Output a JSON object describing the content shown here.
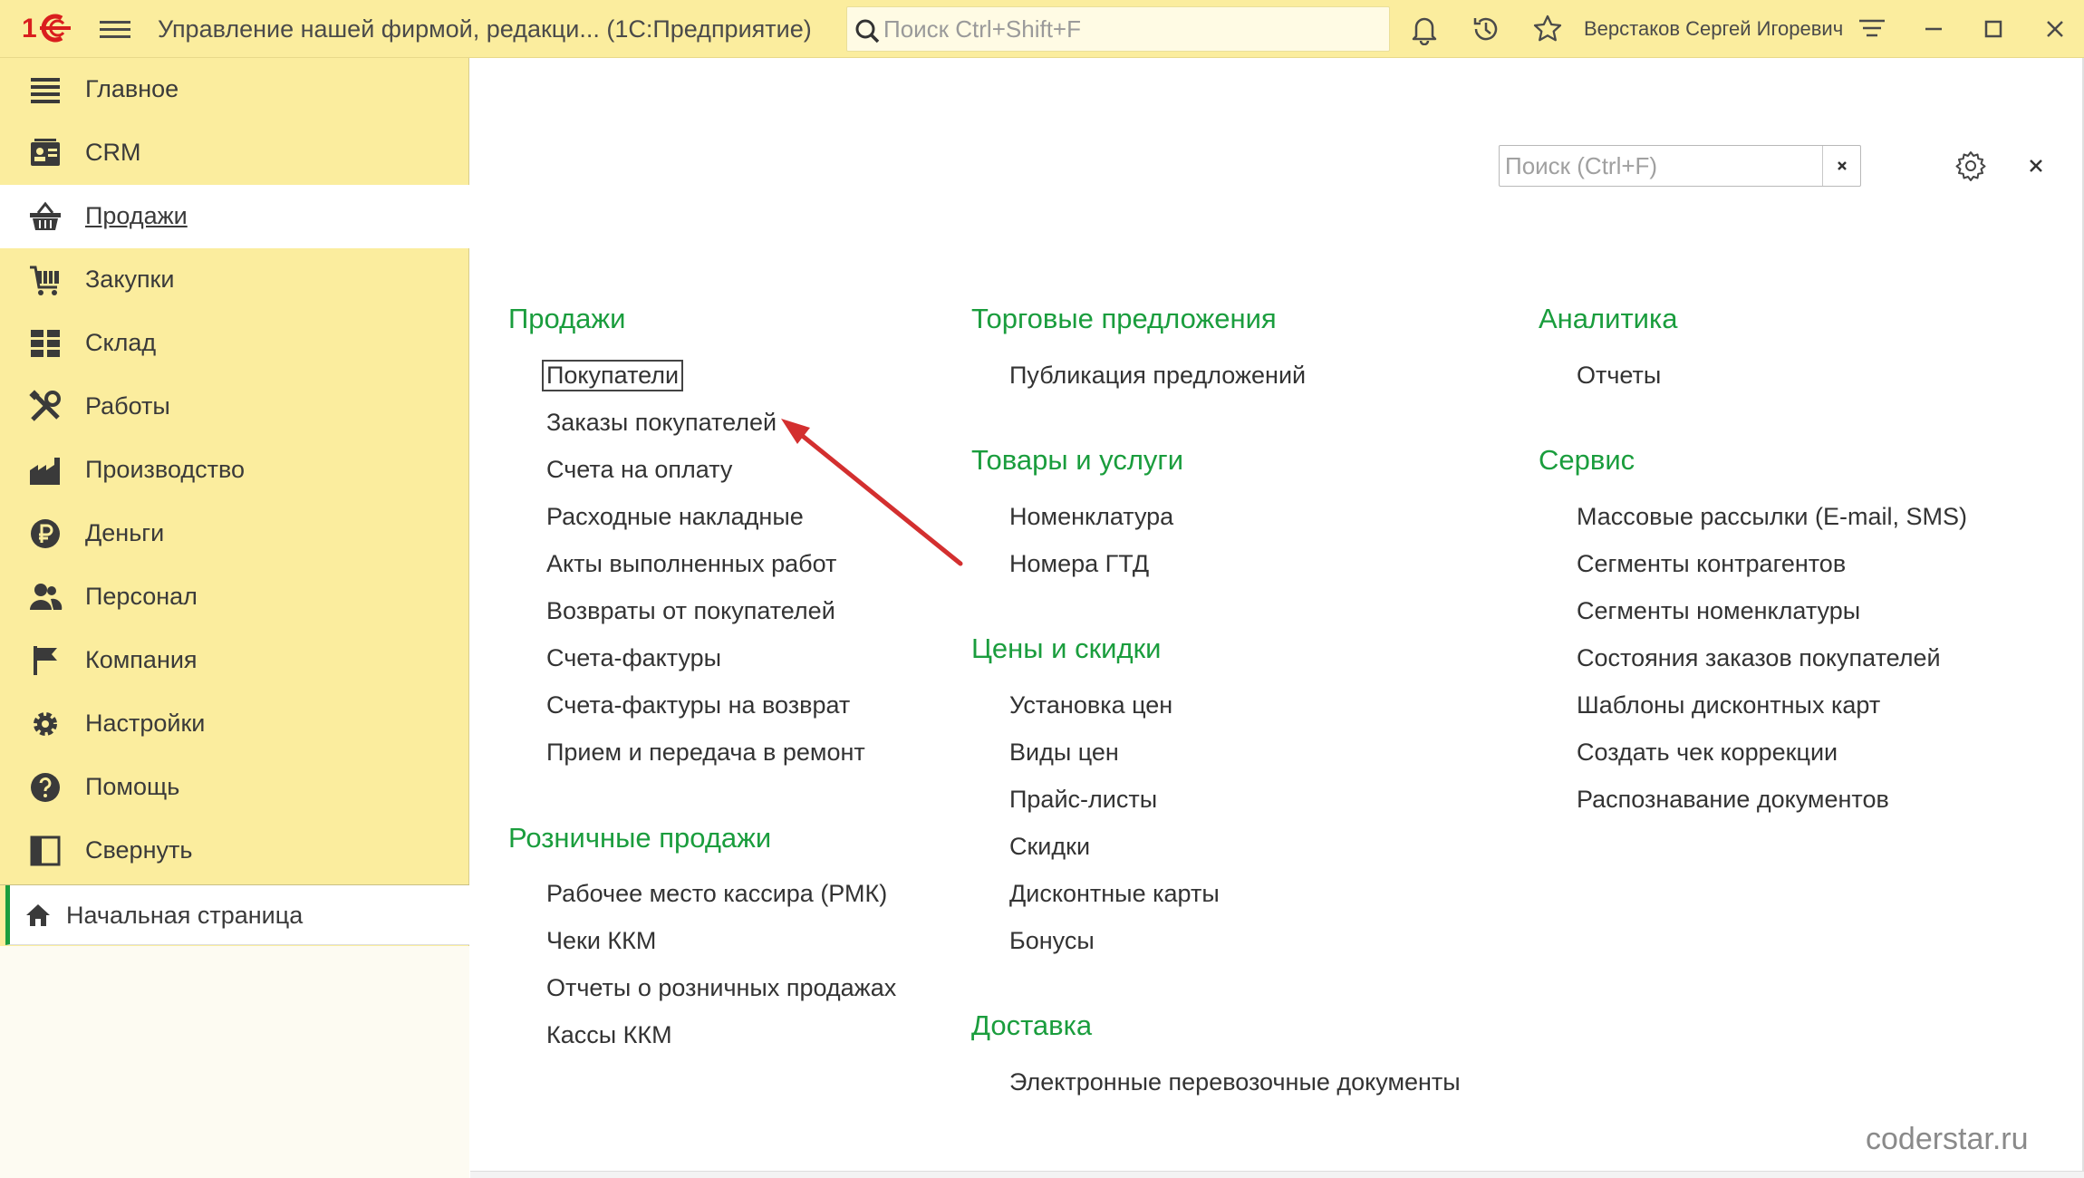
{
  "window": {
    "app_title": "Управление нашей фирмой, редакци...   (1С:Предприятие)",
    "search_placeholder": "Поиск Ctrl+Shift+F",
    "user_name": "Верстаков Сергей Игоревич"
  },
  "sidebar": {
    "items": [
      {
        "label": "Главное",
        "icon": "list-icon"
      },
      {
        "label": "CRM",
        "icon": "contact-card-icon"
      },
      {
        "label": "Продажи",
        "icon": "basket-icon",
        "active": true
      },
      {
        "label": "Закупки",
        "icon": "cart-icon"
      },
      {
        "label": "Склад",
        "icon": "warehouse-grid-icon"
      },
      {
        "label": "Работы",
        "icon": "tools-icon"
      },
      {
        "label": "Производство",
        "icon": "factory-icon"
      },
      {
        "label": "Деньги",
        "icon": "ruble-icon"
      },
      {
        "label": "Персонал",
        "icon": "people-icon"
      },
      {
        "label": "Компания",
        "icon": "flag-icon"
      },
      {
        "label": "Настройки",
        "icon": "gear-icon"
      },
      {
        "label": "Помощь",
        "icon": "help-icon"
      },
      {
        "label": "Свернуть",
        "icon": "collapse-panel-icon"
      }
    ],
    "home_tab": "Начальная страница"
  },
  "content": {
    "search_placeholder": "Поиск (Ctrl+F)",
    "clear_label": "×",
    "close_label": "×",
    "groups": {
      "sales": {
        "title": "Продажи",
        "links": [
          "Покупатели",
          "Заказы покупателей",
          "Счета на оплату",
          "Расходные накладные",
          "Акты выполненных работ",
          "Возвраты от покупателей",
          "Счета-фактуры",
          "Счета-фактуры на возврат",
          "Прием и передача в ремонт"
        ]
      },
      "retail": {
        "title": "Розничные продажи",
        "links": [
          "Рабочее место кассира (РМК)",
          "Чеки ККМ",
          "Отчеты о розничных продажах",
          "Кассы ККМ"
        ]
      },
      "offers": {
        "title": "Торговые предложения",
        "links": [
          "Публикация предложений"
        ]
      },
      "goods": {
        "title": "Товары и услуги",
        "links": [
          "Номенклатура",
          "Номера ГТД"
        ]
      },
      "prices": {
        "title": "Цены и скидки",
        "links": [
          "Установка цен",
          "Виды цен",
          "Прайс-листы",
          "Скидки",
          "Дисконтные карты",
          "Бонусы"
        ]
      },
      "delivery": {
        "title": "Доставка",
        "links": [
          "Электронные перевозочные документы"
        ]
      },
      "analytics": {
        "title": "Аналитика",
        "links": [
          "Отчеты"
        ]
      },
      "service": {
        "title": "Сервис",
        "links": [
          "Массовые рассылки (E-mail, SMS)",
          "Сегменты контрагентов",
          "Сегменты номенклатуры",
          "Состояния заказов покупателей",
          "Шаблоны дисконтных карт",
          "Создать чек коррекции",
          "Распознавание документов"
        ]
      }
    }
  },
  "watermark": "coderstar.ru",
  "colors": {
    "accent_green": "#1a9d3d",
    "panel_yellow": "#fbed9e",
    "logo_red": "#d91e1e",
    "arrow_red": "#d32f2f"
  }
}
